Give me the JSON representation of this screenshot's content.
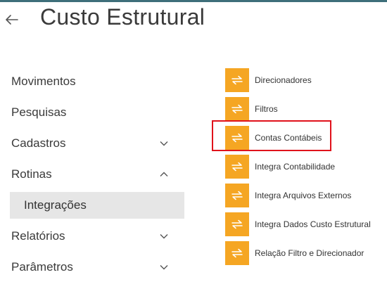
{
  "header": {
    "back_icon": "arrow-left-icon",
    "title": "Custo Estrutural"
  },
  "sidebar": {
    "items": [
      {
        "label": "Movimentos",
        "chevron": null
      },
      {
        "label": "Pesquisas",
        "chevron": null
      },
      {
        "label": "Cadastros",
        "chevron": "chevron-down-icon"
      },
      {
        "label": "Rotinas",
        "chevron": "chevron-up-icon",
        "expanded": true
      },
      {
        "label": "Relatórios",
        "chevron": "chevron-down-icon"
      },
      {
        "label": "Parâmetros",
        "chevron": "chevron-down-icon"
      }
    ],
    "subitem": {
      "label": "Integrações",
      "selected": true
    }
  },
  "tiles": {
    "icon": "swap-arrows-icon",
    "icon_color": "#f5a623",
    "items": [
      {
        "label": "Direcionadores"
      },
      {
        "label": "Filtros"
      },
      {
        "label": "Contas Contábeis",
        "highlighted": true
      },
      {
        "label": "Integra Contabilidade"
      },
      {
        "label": "Integra Arquivos Externos"
      },
      {
        "label": "Integra Dados Custo Estrutural"
      },
      {
        "label": "Relação Filtro e Direcionador"
      }
    ]
  },
  "colors": {
    "highlight_border": "#e0121b",
    "selected_bg": "#e6e6e6",
    "top_strip": "#3e6f7a"
  }
}
